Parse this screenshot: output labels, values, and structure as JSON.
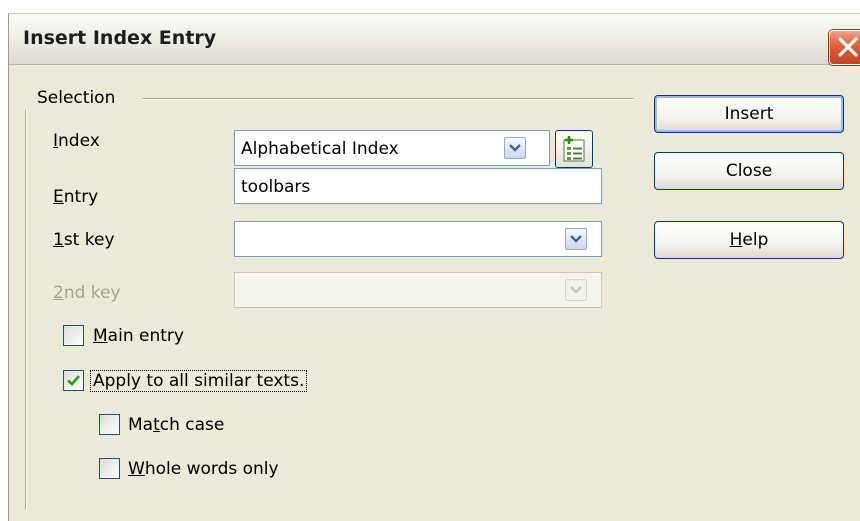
{
  "dialog": {
    "title": "Insert Index Entry"
  },
  "selection": {
    "group_label": "Selection",
    "index": {
      "label": "Index",
      "value": "Alphabetical Index"
    },
    "entry": {
      "label": "Entry",
      "value": "toolbars"
    },
    "first_key": {
      "label": "1st key",
      "value": ""
    },
    "second_key": {
      "label": "2nd key",
      "value": "",
      "disabled": true
    }
  },
  "options": {
    "main_entry": {
      "label": "Main entry",
      "checked": false
    },
    "apply_all": {
      "label": "Apply to all similar texts.",
      "checked": true
    },
    "match_case": {
      "label": "Match case",
      "checked": false
    },
    "whole_words": {
      "label": "Whole words only",
      "checked": false
    }
  },
  "buttons": {
    "insert": "Insert",
    "close": "Close",
    "help": "Help"
  },
  "icons": {
    "close": "close-x-icon",
    "dropdown": "chevron-down-icon",
    "new_index": "new-user-defined-index-icon",
    "check": "checkmark-icon"
  },
  "colors": {
    "close_button": "#d9593a",
    "dialog_bg": "#ece9d8",
    "field_border": "#7f9db9"
  }
}
